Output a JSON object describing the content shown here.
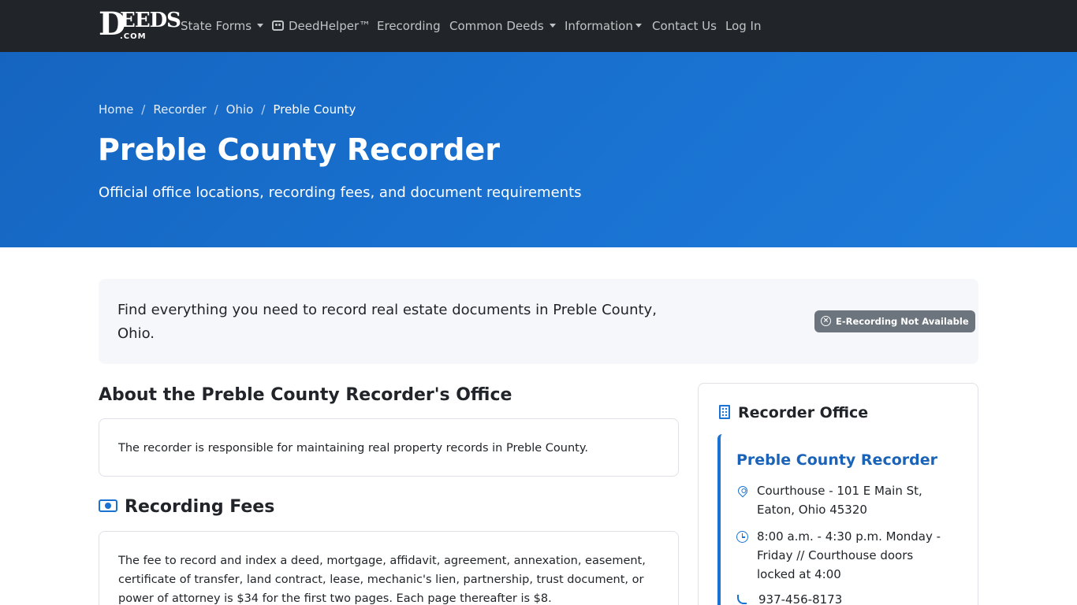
{
  "navbar": {
    "brand": {
      "big": "D",
      "rest": "EEDS",
      "sub": ".COM"
    },
    "items": [
      {
        "label": "State Forms",
        "dropdown": true
      },
      {
        "label": "DeedHelper™",
        "icon": "robot-icon"
      },
      {
        "label": "Erecording"
      },
      {
        "label": "Common Deeds",
        "dropdown": true
      },
      {
        "label": "Information",
        "dropdown": true
      },
      {
        "label": "Contact Us"
      },
      {
        "label": "Log In"
      }
    ]
  },
  "hero": {
    "breadcrumb": [
      "Home",
      "Recorder",
      "Ohio",
      "Preble County"
    ],
    "title": "Preble County Recorder",
    "subtitle": "Official office locations, recording fees, and document requirements"
  },
  "banner": {
    "text": "Find everything you need to record real estate documents in Preble County, Ohio.",
    "badge": "E-Recording Not Available"
  },
  "about": {
    "heading": "About the Preble County Recorder's Office",
    "text": "The recorder is responsible for maintaining real property records in Preble County."
  },
  "fees": {
    "heading": "Recording Fees",
    "text": "The fee to record and index a deed, mortgage, affidavit, agreement, annexation, easement, certificate of transfer, land contract, lease, mechanic's lien, partnership, trust document, or power of attorney is $34 for the first two pages. Each page thereafter is $8."
  },
  "sidebar": {
    "title": "Recorder Office",
    "office": {
      "name": "Preble County Recorder",
      "address": "Courthouse - 101 E Main St, Eaton, Ohio 45320",
      "hours": "8:00 a.m. - 4:30 p.m. Monday - Friday // Courthouse doors locked at 4:00",
      "phone": "937-456-8173"
    }
  },
  "colors": {
    "navbar_bg": "#212529",
    "hero_bg": "#1a73d2",
    "accent": "#1a73d2",
    "badge_bg": "#6c757d"
  }
}
